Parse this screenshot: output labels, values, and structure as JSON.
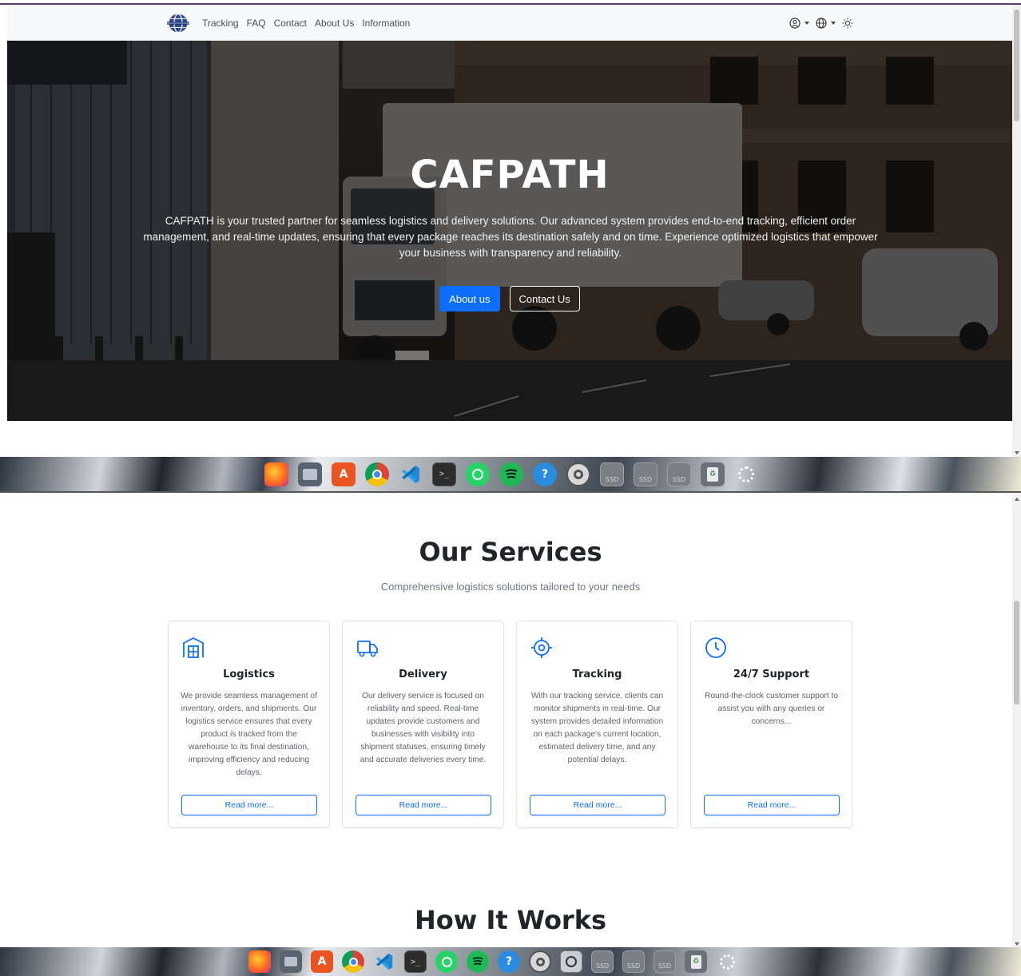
{
  "navbar": {
    "links": [
      "Tracking",
      "FAQ",
      "Contact",
      "About Us",
      "Information"
    ],
    "right_icons": [
      "account-icon",
      "globe-icon",
      "sun-icon"
    ]
  },
  "hero": {
    "title": "CAFPATH",
    "description": "CAFPATH is your trusted partner for seamless logistics and delivery solutions. Our advanced system provides end-to-end tracking, efficient order management, and real-time updates, ensuring that every package reaches its destination safely and on time. Experience optimized logistics that empower your business with transparency and reliability.",
    "primary_button": "About us",
    "secondary_button": "Contact Us"
  },
  "services": {
    "title": "Our Services",
    "subtitle": "Comprehensive logistics solutions tailored to your needs",
    "cards": [
      {
        "icon": "building-icon",
        "title": "Logistics",
        "text": "We provide seamless management of inventory, orders, and shipments. Our logistics service ensures that every product is tracked from the warehouse to its final destination, improving efficiency and reducing delays.",
        "button": "Read more..."
      },
      {
        "icon": "truck-icon",
        "title": "Delivery",
        "text": "Our delivery service is focused on reliability and speed. Real-time updates provide customers and businesses with visibility into shipment statuses, ensuring timely and accurate deliveries every time.",
        "button": "Read more..."
      },
      {
        "icon": "target-icon",
        "title": "Tracking",
        "text": "With our tracking service, clients can monitor shipments in real-time. Our system provides detailed information on each package's current location, estimated delivery time, and any potential delays.",
        "button": "Read more..."
      },
      {
        "icon": "clock-icon",
        "title": "24/7 Support",
        "text": "Round-the-clock customer support to assist you with any queries or concerns...",
        "button": "Read more..."
      }
    ]
  },
  "how_it_works": {
    "title": "How It Works"
  },
  "dock": {
    "ssd_label": "SSD",
    "apps_top": [
      "firefox-icon",
      "files-icon",
      "app-center-icon",
      "chrome-icon",
      "vscode-icon",
      "terminal-icon",
      "whatsapp-icon",
      "spotify-icon",
      "help-icon",
      "settings-icon",
      "ssd-drive-icon",
      "ssd-drive-icon",
      "ssd-drive-icon",
      "trash-icon",
      "ubuntu-icon"
    ],
    "apps_bottom": [
      "firefox-icon",
      "files-icon",
      "app-center-icon",
      "chrome-icon",
      "vscode-icon",
      "terminal-icon",
      "whatsapp-icon",
      "spotify-icon",
      "help-icon",
      "settings-icon",
      "image-viewer-icon",
      "ssd-drive-icon",
      "ssd-drive-icon",
      "ssd-drive-icon",
      "trash-icon",
      "ubuntu-icon"
    ]
  },
  "colors": {
    "primary": "#0d6efd",
    "navbar_bg": "#f8f9fa",
    "hero_overlay": "#1d1b1a"
  }
}
